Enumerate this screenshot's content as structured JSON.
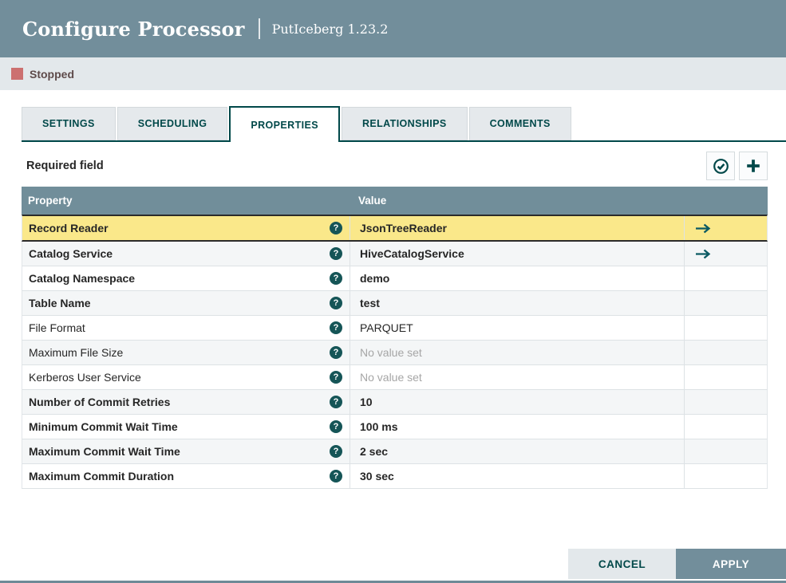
{
  "header": {
    "title": "Configure Processor",
    "subtitle": "PutIceberg 1.23.2"
  },
  "status": {
    "label": "Stopped"
  },
  "tabs": [
    {
      "label": "SETTINGS",
      "active": false
    },
    {
      "label": "SCHEDULING",
      "active": false
    },
    {
      "label": "PROPERTIES",
      "active": true
    },
    {
      "label": "RELATIONSHIPS",
      "active": false
    },
    {
      "label": "COMMENTS",
      "active": false
    }
  ],
  "toolbar": {
    "required_label": "Required field"
  },
  "icons": {
    "verify": "circle-check-icon",
    "add": "plus-icon",
    "help": "question-circle-icon",
    "goto": "right-arrow-icon",
    "stopped": "square-icon",
    "help_glyph": "?"
  },
  "table": {
    "columns": [
      "Property",
      "Value"
    ],
    "rows": [
      {
        "property": "Record Reader",
        "required": true,
        "value": "JsonTreeReader",
        "value_set": true,
        "goto": true,
        "selected": true
      },
      {
        "property": "Catalog Service",
        "required": true,
        "value": "HiveCatalogService",
        "value_set": true,
        "goto": true,
        "selected": false
      },
      {
        "property": "Catalog Namespace",
        "required": true,
        "value": "demo",
        "value_set": true,
        "goto": false,
        "selected": false
      },
      {
        "property": "Table Name",
        "required": true,
        "value": "test",
        "value_set": true,
        "goto": false,
        "selected": false
      },
      {
        "property": "File Format",
        "required": false,
        "value": "PARQUET",
        "value_set": true,
        "goto": false,
        "selected": false
      },
      {
        "property": "Maximum File Size",
        "required": false,
        "value": "No value set",
        "value_set": false,
        "goto": false,
        "selected": false
      },
      {
        "property": "Kerberos User Service",
        "required": false,
        "value": "No value set",
        "value_set": false,
        "goto": false,
        "selected": false
      },
      {
        "property": "Number of Commit Retries",
        "required": true,
        "value": "10",
        "value_set": true,
        "goto": false,
        "selected": false
      },
      {
        "property": "Minimum Commit Wait Time",
        "required": true,
        "value": "100 ms",
        "value_set": true,
        "goto": false,
        "selected": false
      },
      {
        "property": "Maximum Commit Wait Time",
        "required": true,
        "value": "2 sec",
        "value_set": true,
        "goto": false,
        "selected": false
      },
      {
        "property": "Maximum Commit Duration",
        "required": true,
        "value": "30 sec",
        "value_set": true,
        "goto": false,
        "selected": false
      }
    ]
  },
  "footer": {
    "cancel_label": "CANCEL",
    "apply_label": "APPLY"
  },
  "colors": {
    "header_bg": "#728E9B",
    "status_bar_bg": "#E3E8EB",
    "stopped_icon": "#CC7070",
    "stopped_text": "#5E4A4A",
    "accent_teal": "#004849",
    "selected_row_bg": "#FAE88A",
    "selected_row_border": "#2B2B2B",
    "alt_row_bg": "#F4F6F7",
    "table_header_bg": "#718E9A",
    "unset_text": "#A6A6A6",
    "cancel_bg": "#E3E8EB",
    "apply_bg": "#728E9B"
  }
}
